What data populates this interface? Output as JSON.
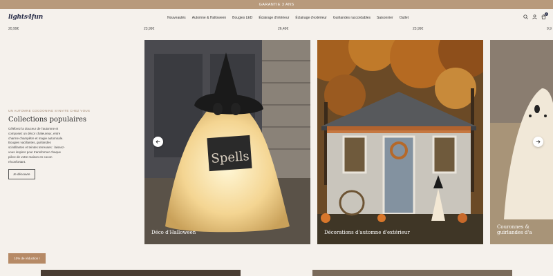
{
  "announcement": "GARANTIE 3 ANS",
  "logo": "lights4fun",
  "nav": [
    "Nouveautés",
    "Automne & Halloween",
    "Bougies LED",
    "Éclairage d'intérieur",
    "Éclairage d'extérieur",
    "Guirlandes raccordables",
    "Saisonnier",
    "Outlet"
  ],
  "cart_count": "0",
  "prices": [
    "20,99€",
    "23,99€",
    "26,49€",
    "23,99€",
    "9,9"
  ],
  "collection": {
    "eyebrow": "UN AUTOMNE COCOONING S'INVITE CHEZ VOUS",
    "title": "Collections populaires",
    "description": "Célébrez la douceur de l'automne et composez un décor chaleureux, entre charme champêtre et magie automnale. Bougies vacillantes, guirlandes scintillantes et teintes terreuses : laissez-vous inspirer pour transformer chaque pièce de votre maison en cocon réconfortant.",
    "cta": "Je découvre"
  },
  "cards": [
    {
      "label": "Déco d'Halloween"
    },
    {
      "label": "Décorations d'automne d'extérieur"
    },
    {
      "label": "Couronnes & guirlandes d'a"
    }
  ],
  "book_text": "Spells",
  "discount": "10% de réduction !"
}
